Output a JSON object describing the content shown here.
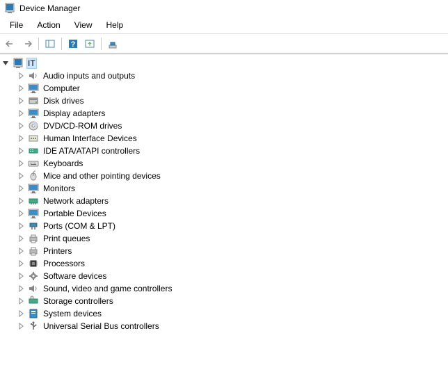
{
  "window": {
    "title": "Device Manager"
  },
  "menus": {
    "file": "File",
    "action": "Action",
    "view": "View",
    "help": "Help"
  },
  "tree": {
    "root": "IT",
    "items": [
      {
        "icon": "speaker",
        "label": "Audio inputs and outputs"
      },
      {
        "icon": "monitor",
        "label": "Computer"
      },
      {
        "icon": "disk",
        "label": "Disk drives"
      },
      {
        "icon": "monitor",
        "label": "Display adapters"
      },
      {
        "icon": "dvd",
        "label": "DVD/CD-ROM drives"
      },
      {
        "icon": "hid",
        "label": "Human Interface Devices"
      },
      {
        "icon": "ide",
        "label": "IDE ATA/ATAPI controllers"
      },
      {
        "icon": "keyboard",
        "label": "Keyboards"
      },
      {
        "icon": "mouse",
        "label": "Mice and other pointing devices"
      },
      {
        "icon": "monitor",
        "label": "Monitors"
      },
      {
        "icon": "network",
        "label": "Network adapters"
      },
      {
        "icon": "monitor",
        "label": "Portable Devices"
      },
      {
        "icon": "port",
        "label": "Ports (COM & LPT)"
      },
      {
        "icon": "printer",
        "label": "Print queues"
      },
      {
        "icon": "printer",
        "label": "Printers"
      },
      {
        "icon": "chip",
        "label": "Processors"
      },
      {
        "icon": "gear",
        "label": "Software devices"
      },
      {
        "icon": "speaker",
        "label": "Sound, video and game controllers"
      },
      {
        "icon": "storage",
        "label": "Storage controllers"
      },
      {
        "icon": "system",
        "label": "System devices"
      },
      {
        "icon": "usb",
        "label": "Universal Serial Bus controllers"
      }
    ]
  }
}
